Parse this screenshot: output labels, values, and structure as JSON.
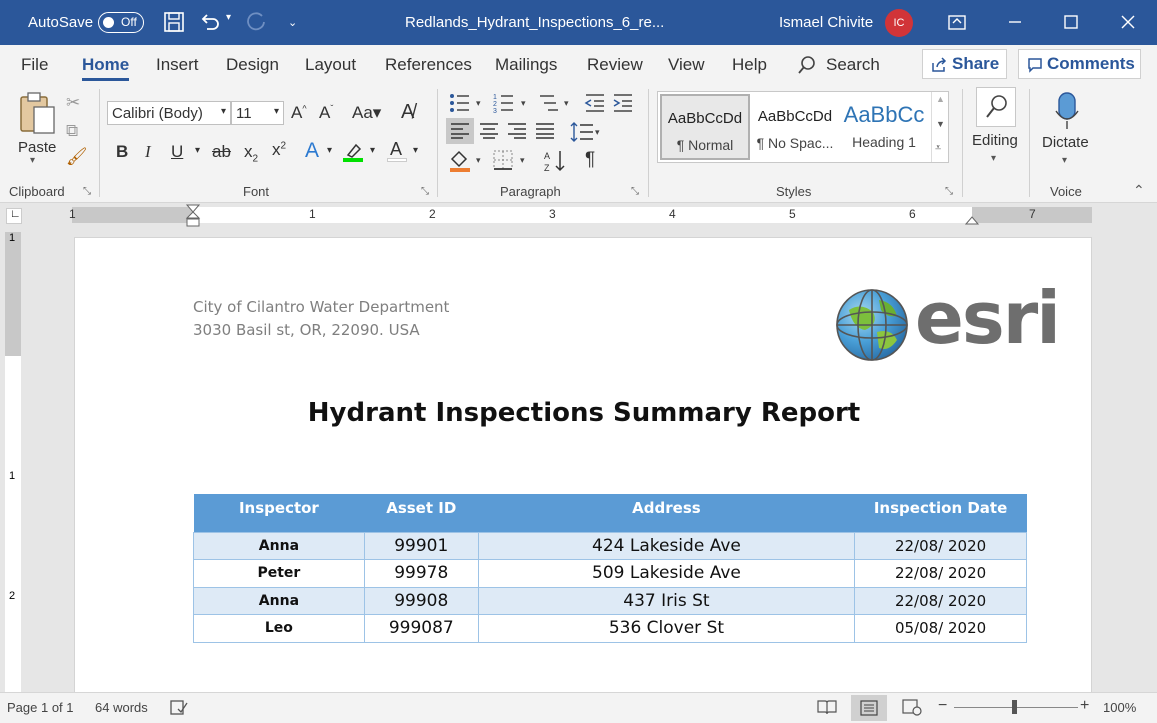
{
  "titlebar": {
    "autosave_label": "AutoSave",
    "autosave_state": "Off",
    "doc_title": "Redlands_Hydrant_Inspections_6_re...",
    "user_name": "Ismael Chivite",
    "user_initials": "IC",
    "accent_color": "#2b579a"
  },
  "tabs": [
    "File",
    "Home",
    "Insert",
    "Design",
    "Layout",
    "References",
    "Mailings",
    "Review",
    "View",
    "Help"
  ],
  "search_label": "Search",
  "share_label": "Share",
  "comments_label": "Comments",
  "ribbon": {
    "clipboard": {
      "paste": "Paste",
      "label": "Clipboard"
    },
    "font": {
      "family": "Calibri (Body)",
      "size": "11",
      "label": "Font"
    },
    "paragraph": {
      "label": "Paragraph"
    },
    "styles": {
      "label": "Styles",
      "items": [
        {
          "sample": "AaBbCcDd",
          "name": "¶ Normal"
        },
        {
          "sample": "AaBbCcDd",
          "name": "¶ No Spac..."
        },
        {
          "sample": "AaBbCc",
          "name": "Heading 1"
        }
      ]
    },
    "editing": {
      "label": "Editing"
    },
    "voice": {
      "dictate": "Dictate",
      "label": "Voice"
    }
  },
  "ruler": {
    "numbers": [
      "1",
      "1",
      "2",
      "3",
      "4",
      "5",
      "6",
      "7"
    ],
    "vertical": [
      "1",
      "1",
      "2"
    ]
  },
  "document": {
    "org_line1": "City of Cilantro Water Department",
    "org_line2": "3030 Basil st, OR, 22090. USA",
    "logo_text": "esri",
    "title": "Hydrant Inspections Summary Report",
    "table": {
      "headers": [
        "Inspector",
        "Asset ID",
        "Address",
        "Inspection Date"
      ],
      "rows": [
        [
          "Anna",
          "99901",
          "424 Lakeside Ave",
          "22/08/ 2020"
        ],
        [
          "Peter",
          "99978",
          "509 Lakeside Ave",
          "22/08/ 2020"
        ],
        [
          "Anna",
          "99908",
          "437 Iris St",
          "22/08/ 2020"
        ],
        [
          "Leo",
          "999087",
          "536 Clover St",
          "05/08/ 2020"
        ]
      ]
    }
  },
  "status": {
    "page": "Page 1 of 1",
    "words": "64 words",
    "zoom": "100%"
  }
}
